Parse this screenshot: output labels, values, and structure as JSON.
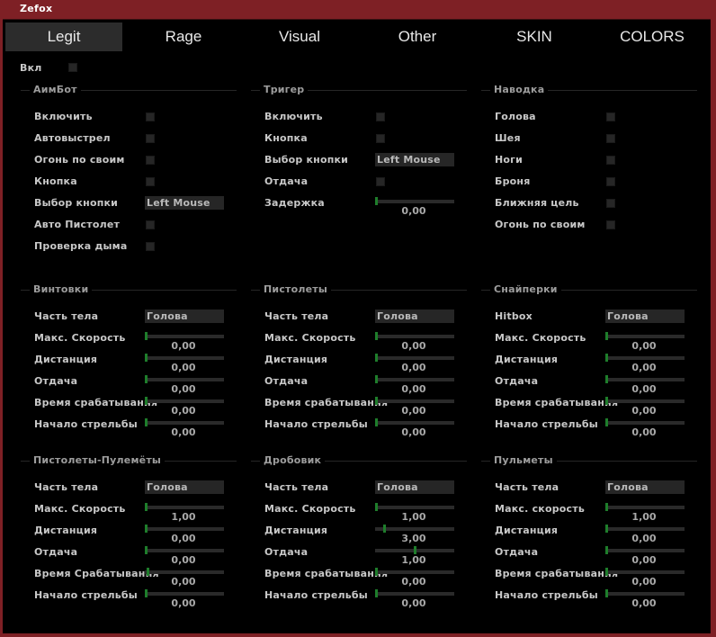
{
  "window": {
    "title": "Zefox"
  },
  "tabs": [
    "Legit",
    "Rage",
    "Visual",
    "Other",
    "SKIN",
    "COLORS"
  ],
  "enable_label": "Вкл",
  "aimbot": {
    "title": "АимБот",
    "rows": [
      {
        "label": "Включить",
        "type": "check"
      },
      {
        "label": "Автовыстрел",
        "type": "check"
      },
      {
        "label": "Огонь по своим",
        "type": "check"
      },
      {
        "label": "Кнопка",
        "type": "check"
      },
      {
        "label": "Выбор кнопки",
        "type": "drop",
        "value": "Left Mouse"
      },
      {
        "label": "Авто Пистолет",
        "type": "check"
      },
      {
        "label": "Проверка дыма",
        "type": "check"
      }
    ]
  },
  "trigger": {
    "title": "Тригер",
    "rows": [
      {
        "label": "Включить",
        "type": "check"
      },
      {
        "label": "Кнопка",
        "type": "check"
      },
      {
        "label": "Выбор кнопки",
        "type": "drop",
        "value": "Left Mouse"
      },
      {
        "label": "Отдача",
        "type": "check"
      },
      {
        "label": "Задержка",
        "type": "slider",
        "value": "0,00",
        "level": 0
      }
    ]
  },
  "aim_target": {
    "title": "Наводка",
    "rows": [
      {
        "label": "Голова",
        "type": "check"
      },
      {
        "label": "Шея",
        "type": "check"
      },
      {
        "label": "Ноги",
        "type": "check"
      },
      {
        "label": "Броня",
        "type": "check"
      },
      {
        "label": "Ближняя цель",
        "type": "check"
      },
      {
        "label": "Огонь по своим",
        "type": "check"
      }
    ]
  },
  "rifles": {
    "title": "Винтовки",
    "rows": [
      {
        "label": "Часть тела",
        "type": "drop",
        "value": "Голова"
      },
      {
        "label": "Макс. Скорость",
        "type": "slider",
        "value": "0,00",
        "level": 0
      },
      {
        "label": "Дистанция",
        "type": "slider",
        "value": "0,00",
        "level": 0
      },
      {
        "label": "Отдача",
        "type": "slider",
        "value": "0,00",
        "level": 0
      },
      {
        "label": "Время срабатывания",
        "type": "slider",
        "value": "0,00",
        "level": 0
      },
      {
        "label": "Начало стрельбы",
        "type": "slider",
        "value": "0,00",
        "level": 0
      }
    ]
  },
  "pistols": {
    "title": "Пистолеты",
    "rows": [
      {
        "label": "Часть тела",
        "type": "drop",
        "value": "Голова"
      },
      {
        "label": "Макс. Скорость",
        "type": "slider",
        "value": "0,00",
        "level": 0
      },
      {
        "label": "Дистанция",
        "type": "slider",
        "value": "0,00",
        "level": 0
      },
      {
        "label": "Отдача",
        "type": "slider",
        "value": "0,00",
        "level": 0
      },
      {
        "label": "Время срабатывания",
        "type": "slider",
        "value": "0,00",
        "level": 0
      },
      {
        "label": "Начало стрельбы",
        "type": "slider",
        "value": "0,00",
        "level": 0
      }
    ]
  },
  "snipers": {
    "title": "Снайперки",
    "rows": [
      {
        "label": "Hitbox",
        "type": "drop",
        "value": "Голова"
      },
      {
        "label": "Макс. Скорость",
        "type": "slider",
        "value": "0,00",
        "level": 0
      },
      {
        "label": "Дистанция",
        "type": "slider",
        "value": "0,00",
        "level": 0
      },
      {
        "label": "Отдача",
        "type": "slider",
        "value": "0,00",
        "level": 0
      },
      {
        "label": "Время срабатывания",
        "type": "slider",
        "value": "0,00",
        "level": 0
      },
      {
        "label": "Начало стрельбы",
        "type": "slider",
        "value": "0,00",
        "level": 0
      }
    ]
  },
  "smgs": {
    "title": "Пистолеты-Пулемёты",
    "rows": [
      {
        "label": "Часть тела",
        "type": "drop",
        "value": "Голова"
      },
      {
        "label": "Макс. Скорость",
        "type": "slider",
        "value": "1,00",
        "level": 0
      },
      {
        "label": "Дистанция",
        "type": "slider",
        "value": "0,00",
        "level": 0
      },
      {
        "label": "Отдача",
        "type": "slider",
        "value": "0,00",
        "level": 0
      },
      {
        "label": "Время Срабатывания",
        "type": "slider",
        "value": "0,00",
        "level": 0.02
      },
      {
        "label": "Начало стрельбы",
        "type": "slider",
        "value": "0,00",
        "level": 0
      }
    ]
  },
  "shotguns": {
    "title": "Дробовик",
    "rows": [
      {
        "label": "Часть тела",
        "type": "drop",
        "value": "Голова"
      },
      {
        "label": "Макс. Скорость",
        "type": "slider",
        "value": "1,00",
        "level": 0
      },
      {
        "label": "Дистанция",
        "type": "slider",
        "value": "3,00",
        "level": 0.11
      },
      {
        "label": "Отдача",
        "type": "slider",
        "value": "1,00",
        "level": 0.5
      },
      {
        "label": "Время срабатывания",
        "type": "slider",
        "value": "0,00",
        "level": 0
      },
      {
        "label": "Начало стрельбы",
        "type": "slider",
        "value": "0,00",
        "level": 0
      }
    ]
  },
  "machineguns": {
    "title": "Пульметы",
    "rows": [
      {
        "label": "Часть тела",
        "type": "drop",
        "value": "Голова"
      },
      {
        "label": "Макс. скорость",
        "type": "slider",
        "value": "1,00",
        "level": 0
      },
      {
        "label": "Дистанция",
        "type": "slider",
        "value": "0,00",
        "level": 0
      },
      {
        "label": "Отдача",
        "type": "slider",
        "value": "0,00",
        "level": 0
      },
      {
        "label": "Время срабатывания",
        "type": "slider",
        "value": "0,00",
        "level": 0
      },
      {
        "label": "Начало стрельбы",
        "type": "slider",
        "value": "0,00",
        "level": 0
      }
    ]
  },
  "colors": {
    "frame": "#7e2025",
    "slider_thumb": "#1e7d2b",
    "active_tab": "#2c2c2c"
  }
}
